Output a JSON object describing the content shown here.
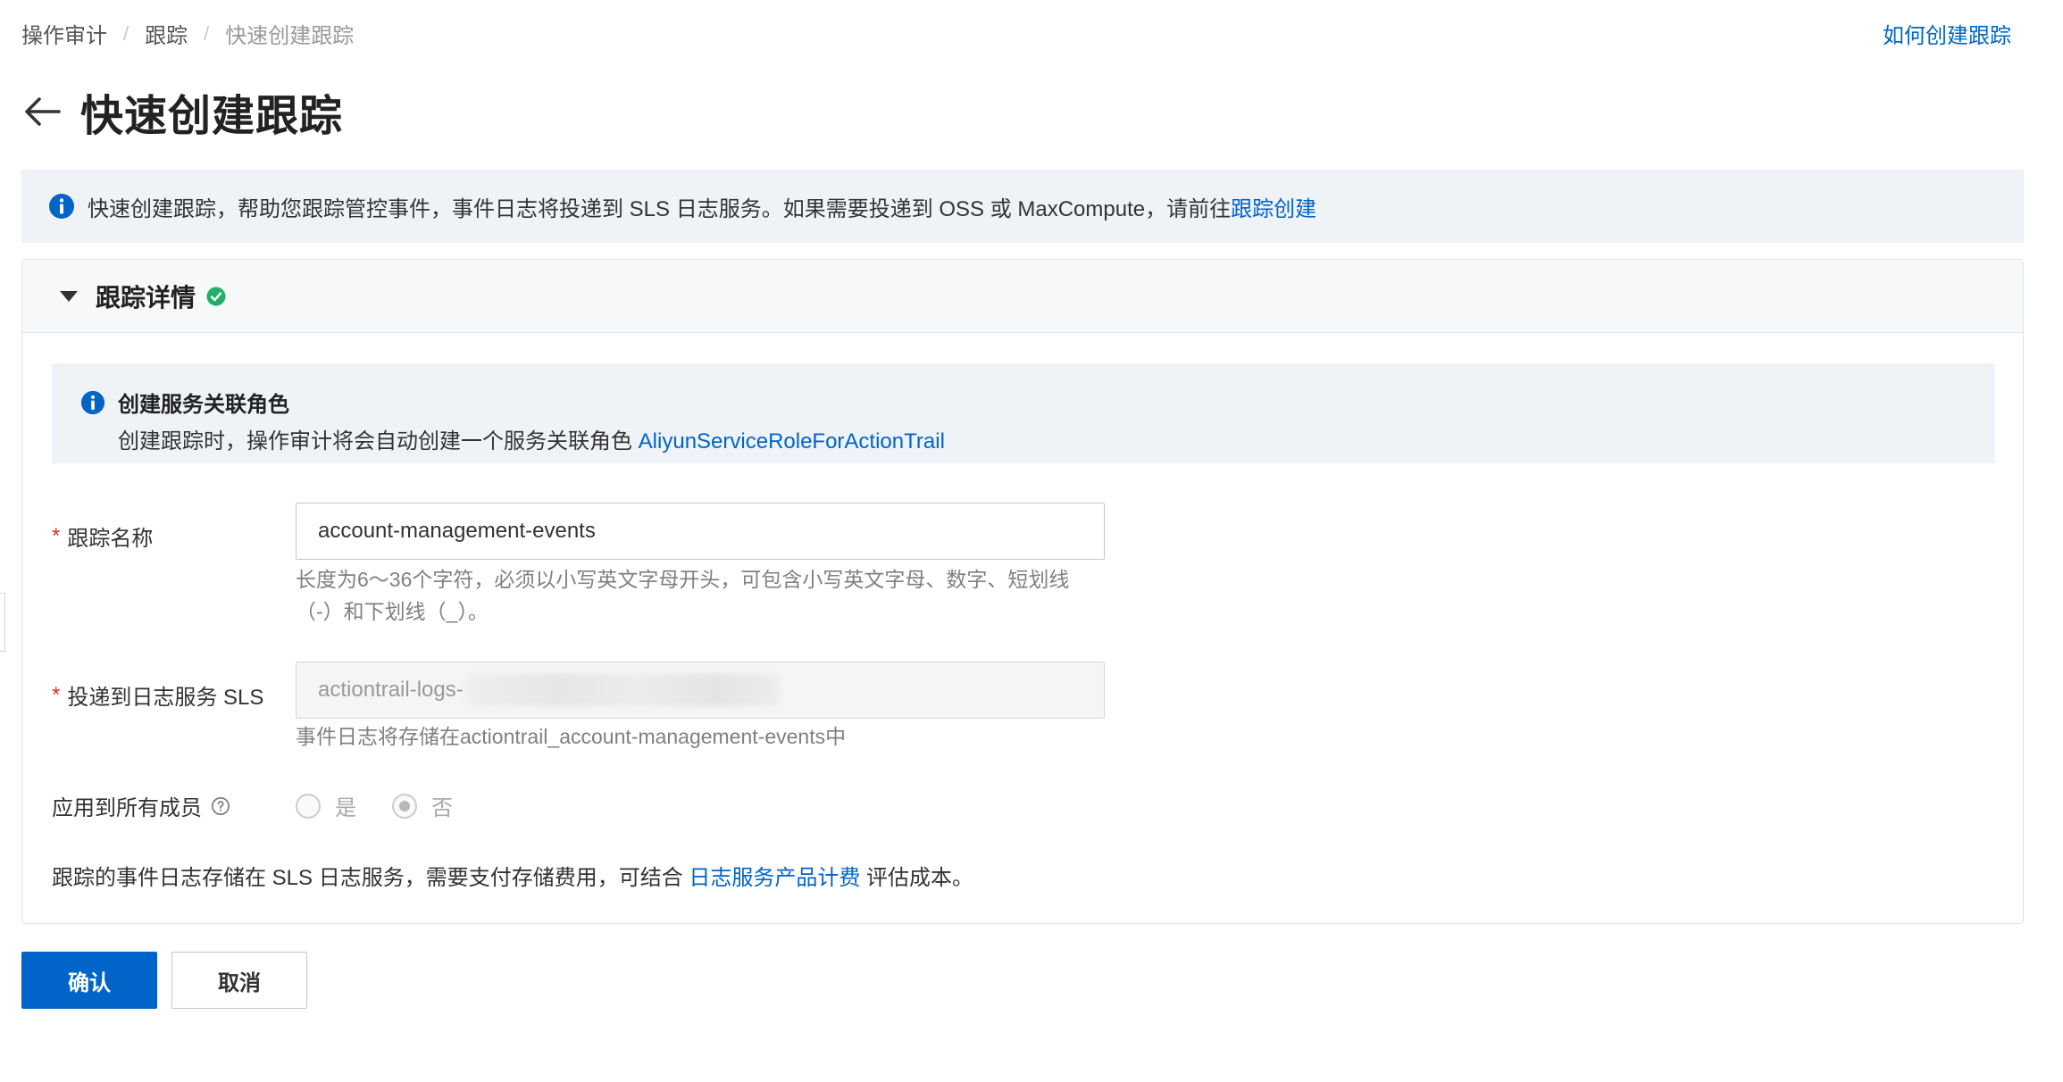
{
  "breadcrumb": [
    "操作审计",
    "跟踪",
    "快速创建跟踪"
  ],
  "help_link": "如何创建跟踪",
  "page_title": "快速创建跟踪",
  "banner": {
    "text": "快速创建跟踪，帮助您跟踪管控事件，事件日志将投递到 SLS 日志服务。如果需要投递到 OSS 或 MaxCompute，请前往 ",
    "link": "跟踪创建"
  },
  "panel": {
    "title": "跟踪详情",
    "role": {
      "title": "创建服务关联角色",
      "desc": "创建跟踪时，操作审计将会自动创建一个服务关联角色 ",
      "link": "AliyunServiceRoleForActionTrail"
    },
    "name_field": {
      "label": "跟踪名称",
      "value": "account-management-events",
      "hint": "长度为6～36个字符，必须以小写英文字母开头，可包含小写英文字母、数字、短划线（-）和下划线（_）。"
    },
    "sls_field": {
      "label": "投递到日志服务 SLS",
      "value": "actiontrail-logs-",
      "hint": "事件日志将存储在actiontrail_account-management-events中"
    },
    "apply_all": {
      "label": "应用到所有成员",
      "options": [
        "是",
        "否"
      ],
      "selected": "否"
    },
    "cost_note": {
      "prefix": "跟踪的事件日志存储在 SLS 日志服务，需要支付存储费用，可结合 ",
      "link": "日志服务产品计费",
      "suffix": " 评估成本。"
    }
  },
  "buttons": {
    "confirm": "确认",
    "cancel": "取消"
  },
  "colors": {
    "primary": "#0064c8",
    "required": "#d93026",
    "success": "#23b066",
    "banner_bg": "#eff3f8"
  }
}
